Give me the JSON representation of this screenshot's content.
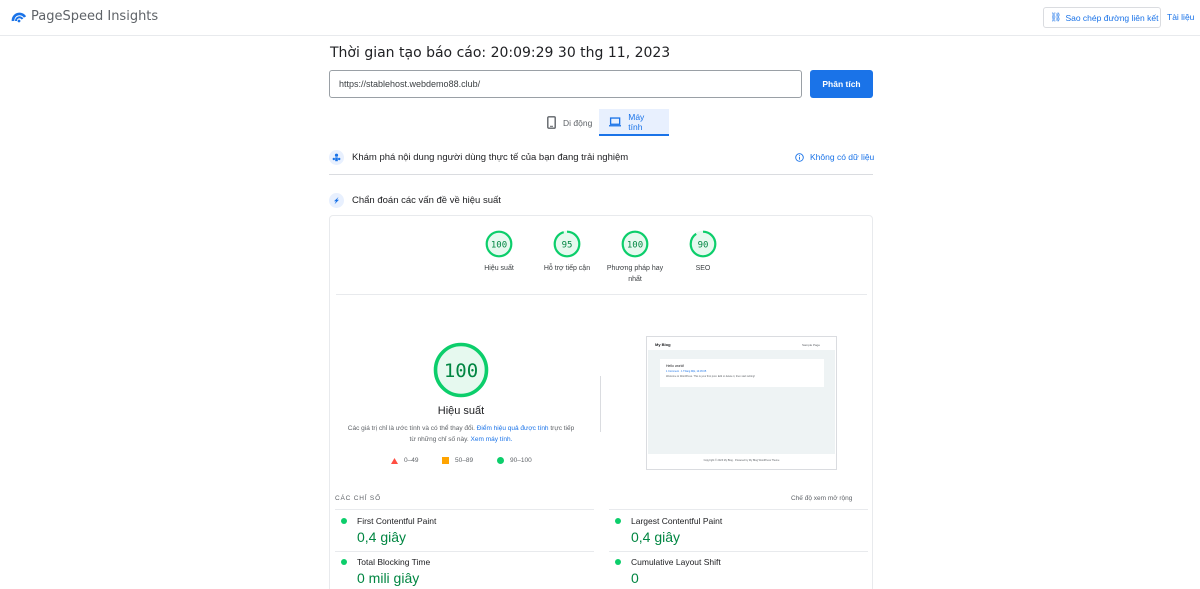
{
  "header": {
    "brand": "PageSpeed Insights",
    "copy_link": "Sao chép đường liên kết",
    "docs": "Tài liệu"
  },
  "report": {
    "time": "Thời gian tạo báo cáo: 20:09:29 30 thg 11, 2023",
    "url": "https://stablehost.webdemo88.club/",
    "analyze": "Phân tích"
  },
  "tabs": [
    {
      "label": "Di động",
      "selected": false
    },
    {
      "label": "Máy tính",
      "selected": true
    }
  ],
  "crux": {
    "label": "Khám phá nội dung người dùng thực tế của bạn đang trải nghiệm",
    "no_data": "Không có dữ liệu"
  },
  "diagnose": {
    "label": "Chẩn đoán các vấn đề về hiệu suất"
  },
  "scores": [
    {
      "value": "100",
      "label": "Hiệu suất",
      "score": 100
    },
    {
      "value": "95",
      "label": "Hỗ trợ tiếp cận",
      "score": 95
    },
    {
      "value": "100",
      "label": "Phương pháp hay nhất",
      "score": 100
    },
    {
      "value": "90",
      "label": "SEO",
      "score": 90
    }
  ],
  "performance": {
    "score": "100",
    "title": "Hiệu suất",
    "note_prefix": "Các giá trị chỉ là ước tính và có thể thay đổi.",
    "note_link1": "Điểm hiệu quả được tính",
    "note_middle": "trực tiếp từ những chỉ số này.",
    "note_link2": "Xem máy tính."
  },
  "legend": [
    {
      "range": "0–49",
      "color": "#ff4e42",
      "shape": "triangle"
    },
    {
      "range": "50–89",
      "color": "#ffa400",
      "shape": "square"
    },
    {
      "range": "90–100",
      "color": "#0cce6b",
      "shape": "circle"
    }
  ],
  "thumbnail": {
    "site_title": "My Blog",
    "nav": "Sample Page",
    "post_title": "Hello world!",
    "post_meta": "1 Comment · 1 Tháng Một, 14:45:05",
    "post_text": "Welcome to WordPress. This is your first post. Edit or delete it, then start writing!",
    "footer": "Copyright © 2023 My Blog · Powered by My Blog WordPress Theme"
  },
  "metrics": {
    "title": "CÁC CHỈ SỐ",
    "expand": "Chế độ xem mở rộng",
    "items": [
      {
        "name": "First Contentful Paint",
        "value": "0,4 giây"
      },
      {
        "name": "Largest Contentful Paint",
        "value": "0,4 giây"
      },
      {
        "name": "Total Blocking Time",
        "value": "0 mili giây"
      },
      {
        "name": "Cumulative Layout Shift",
        "value": "0"
      }
    ]
  },
  "colors": {
    "accent": "#1a73e8",
    "pass": "#0cce6b",
    "pass_text": "#018642"
  }
}
